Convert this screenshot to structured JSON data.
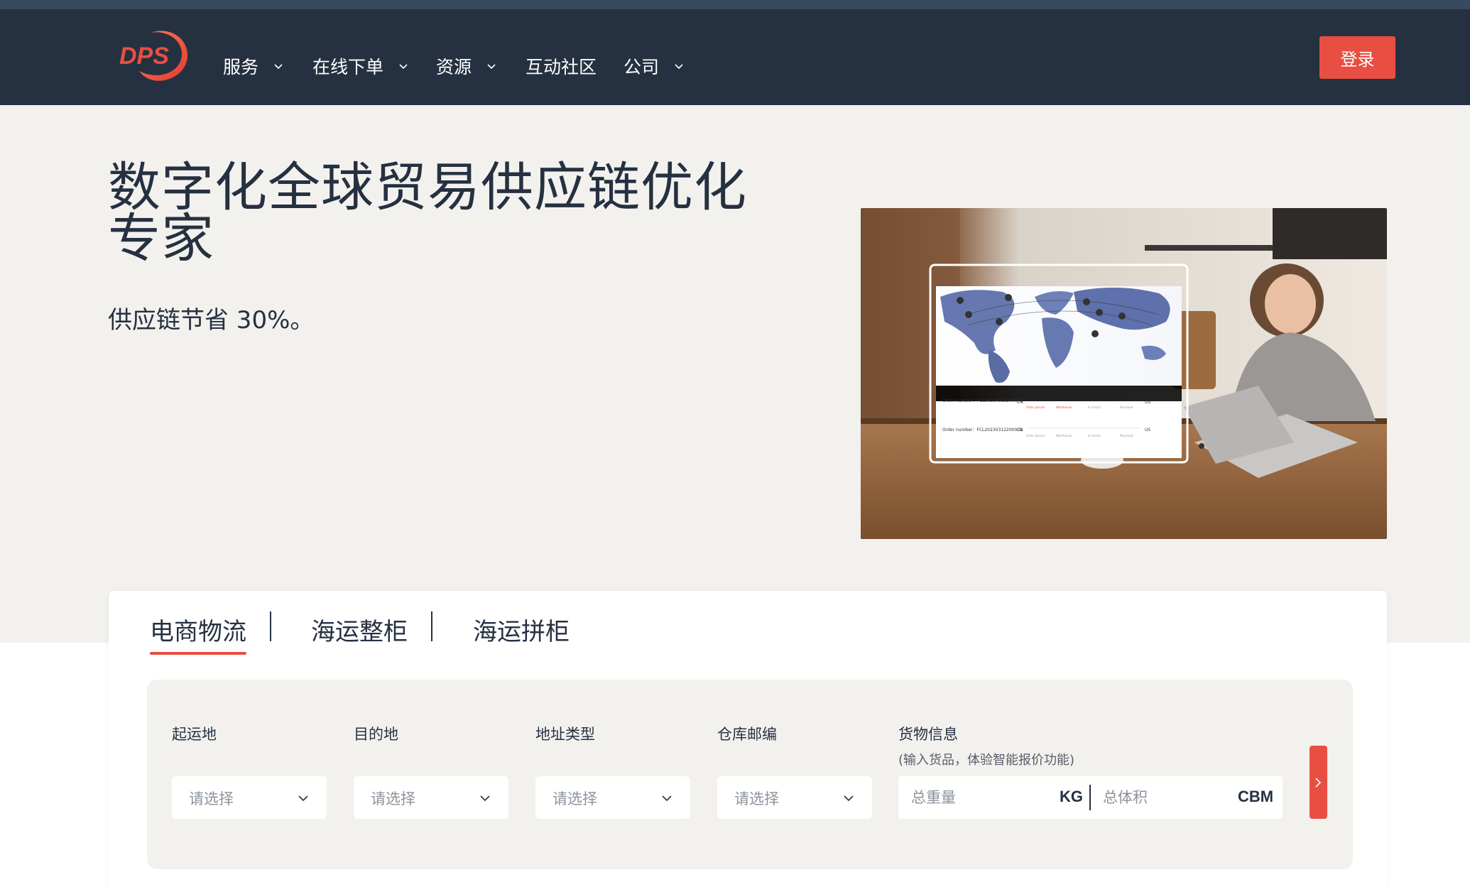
{
  "brand": {
    "logo_text": "DPS",
    "accent": "#e94e42",
    "nav_bg": "#253141"
  },
  "nav": {
    "items": [
      {
        "label": "服务",
        "has_dropdown": true
      },
      {
        "label": "在线下单",
        "has_dropdown": true
      },
      {
        "label": "资源",
        "has_dropdown": true
      },
      {
        "label": "互动社区",
        "has_dropdown": false
      },
      {
        "label": "公司",
        "has_dropdown": true
      }
    ],
    "login_label": "登录"
  },
  "hero": {
    "title": "数字化全球贸易供应链优化专家",
    "subtitle": "供应链节省 30%。",
    "image": {
      "orders": [
        {
          "label": "Order number：FCL20230312200002",
          "from": "CN",
          "to": "US"
        },
        {
          "label": "Order number：FCL20230312200001",
          "from": "CN",
          "to": "US"
        }
      ],
      "steps": [
        "Order placed",
        "Warehouse",
        "In transit",
        "Received"
      ]
    }
  },
  "quote": {
    "tabs": [
      {
        "label": "电商物流",
        "active": true
      },
      {
        "label": "海运整柜",
        "active": false
      },
      {
        "label": "海运拼柜",
        "active": false
      }
    ],
    "fields": [
      {
        "label": "起运地",
        "placeholder": "请选择"
      },
      {
        "label": "目的地",
        "placeholder": "请选择"
      },
      {
        "label": "地址类型",
        "placeholder": "请选择"
      },
      {
        "label": "仓库邮编",
        "placeholder": "请选择"
      }
    ],
    "cargo": {
      "label": "货物信息",
      "note": "(输入货品，体验智能报价功能)",
      "weight_placeholder": "总重量",
      "weight_unit": "KG",
      "volume_placeholder": "总体积",
      "volume_unit": "CBM"
    }
  }
}
